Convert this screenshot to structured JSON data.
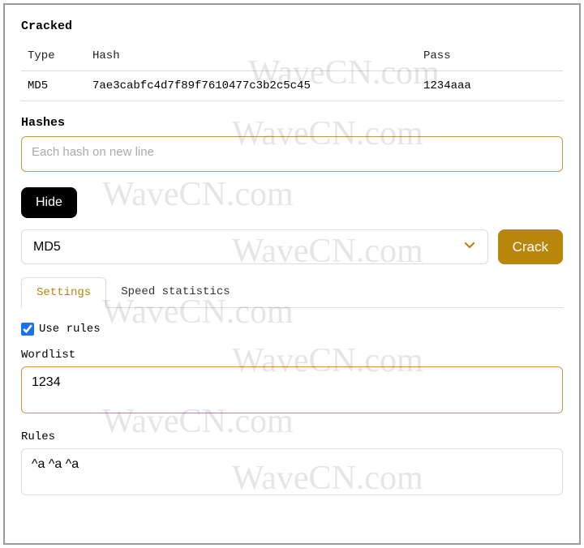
{
  "cracked": {
    "title": "Cracked",
    "columns": {
      "type": "Type",
      "hash": "Hash",
      "pass": "Pass"
    },
    "rows": [
      {
        "type": "MD5",
        "hash": "7ae3cabfc4d7f89f7610477c3b2c5c45",
        "pass": "1234aaa"
      }
    ]
  },
  "hashes": {
    "label": "Hashes",
    "placeholder": "Each hash on new line",
    "value": ""
  },
  "hide_label": "Hide",
  "algorithm_select": {
    "value": "MD5"
  },
  "crack_label": "Crack",
  "tabs": {
    "settings": "Settings",
    "speed": "Speed statistics"
  },
  "use_rules": {
    "label": "Use rules",
    "checked": true
  },
  "wordlist": {
    "label": "Wordlist",
    "value": "1234"
  },
  "rules": {
    "label": "Rules",
    "value": "^a ^a ^a"
  },
  "watermark": "WaveCN.com"
}
